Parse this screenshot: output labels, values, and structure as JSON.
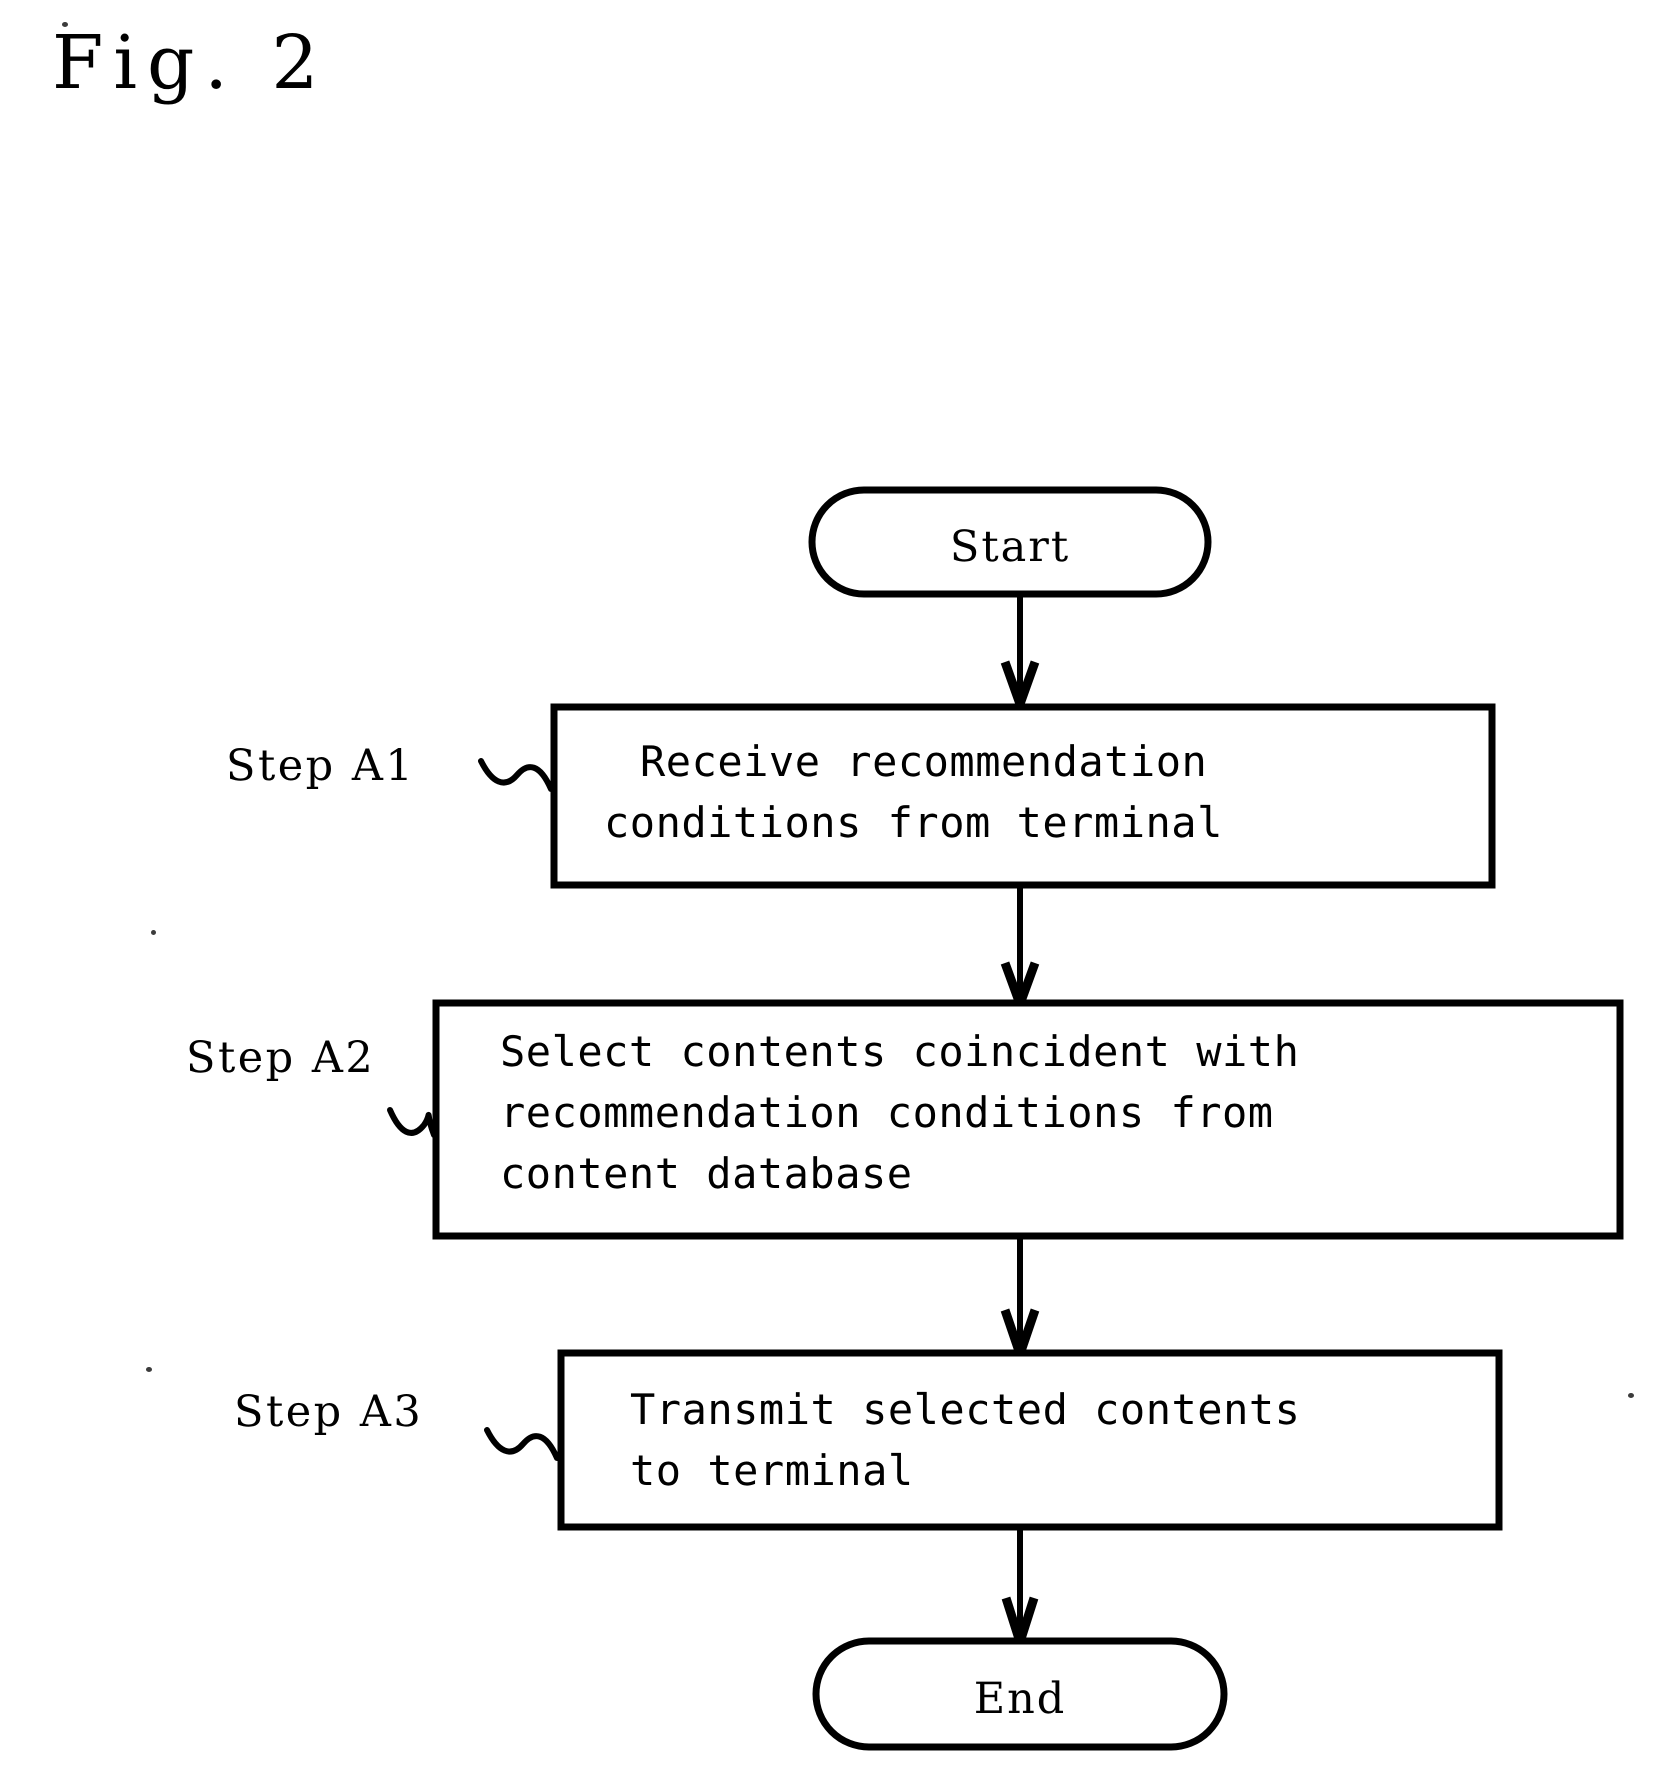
{
  "figure": {
    "title": "Fig. 2",
    "type": "flowchart",
    "background_color": "#ffffff",
    "line_color": "#000000"
  },
  "nodes": [
    {
      "id": "start",
      "shape": "terminator",
      "label": "Start",
      "step_label": null
    },
    {
      "id": "a1",
      "shape": "process",
      "label_lines": [
        "Receive recommendation",
        "conditions from terminal"
      ],
      "step_label": "Step A1"
    },
    {
      "id": "a2",
      "shape": "process",
      "label_lines": [
        "Select contents coincident with",
        "recommendation conditions from",
        "content database"
      ],
      "step_label": "Step A2"
    },
    {
      "id": "a3",
      "shape": "process",
      "label_lines": [
        "Transmit selected contents",
        "to terminal"
      ],
      "step_label": "Step A3"
    },
    {
      "id": "end",
      "shape": "terminator",
      "label": "End",
      "step_label": null
    }
  ],
  "text": {
    "title": "Fig. 2",
    "start": "Start",
    "end": "End",
    "step_a1": "Step A1",
    "step_a2": "Step A2",
    "step_a3": "Step A3",
    "a1_line1": "Receive recommendation",
    "a1_line2": "conditions from terminal",
    "a2_line1": "Select contents coincident with",
    "a2_line2": "recommendation conditions from",
    "a2_line3": "content database",
    "a3_line1": "Transmit selected contents",
    "a3_line2": "to terminal"
  },
  "edges": [
    {
      "from": "start",
      "to": "a1",
      "arrow": "down"
    },
    {
      "from": "a1",
      "to": "a2",
      "arrow": "down"
    },
    {
      "from": "a2",
      "to": "a3",
      "arrow": "down"
    },
    {
      "from": "a3",
      "to": "end",
      "arrow": "down"
    }
  ],
  "leaders": [
    {
      "for": "a1",
      "style": "tilde-squiggle"
    },
    {
      "for": "a2",
      "style": "tilde-squiggle"
    },
    {
      "for": "a3",
      "style": "tilde-squiggle"
    }
  ]
}
